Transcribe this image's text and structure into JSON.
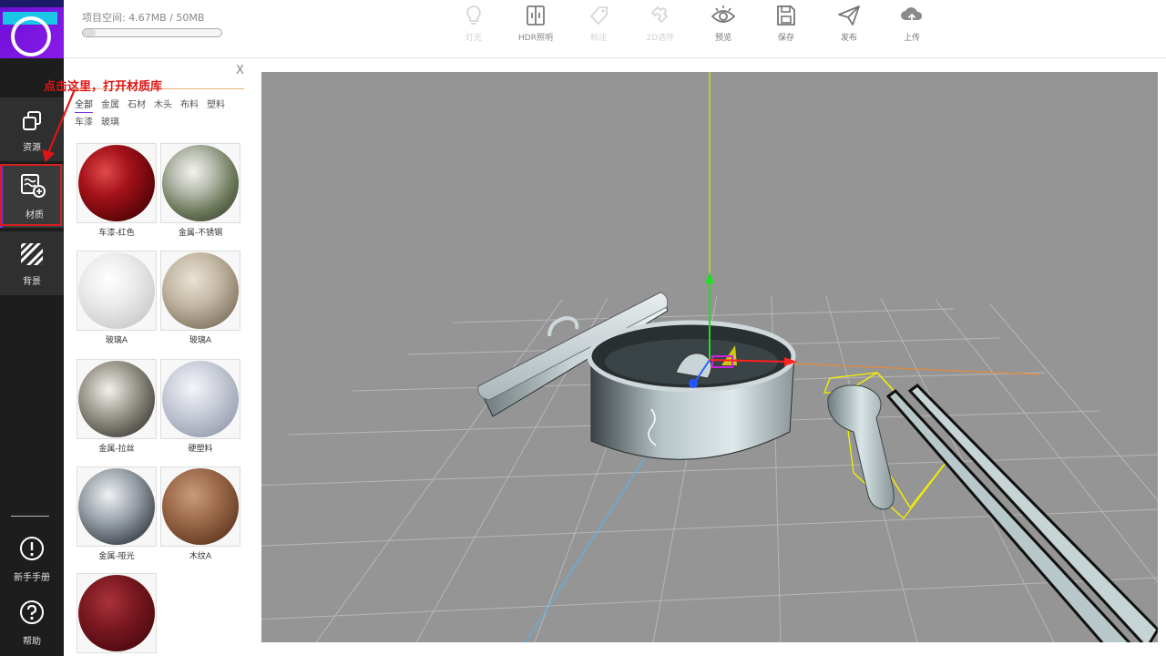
{
  "sidebar": {
    "items": [
      {
        "label": "资源"
      },
      {
        "label": "材质"
      },
      {
        "label": "背景"
      },
      {
        "label": "新手手册"
      },
      {
        "label": "帮助"
      }
    ]
  },
  "annotation": {
    "text": "点击这里，打开材质库",
    "color": "#e01414"
  },
  "header": {
    "space_label": "项目空间: 4.67MB / 50MB",
    "space_used_fraction": 0.09,
    "tools": [
      {
        "label": "灯光",
        "icon": "bulb-icon",
        "enabled": false
      },
      {
        "label": "HDR照明",
        "icon": "hdr-icon",
        "enabled": false
      },
      {
        "label": "标注",
        "icon": "tag-icon",
        "enabled": false
      },
      {
        "label": "2D选件",
        "icon": "puzzle-icon",
        "enabled": false
      },
      {
        "label": "预览",
        "icon": "eye-icon",
        "enabled": true
      },
      {
        "label": "保存",
        "icon": "save-icon",
        "enabled": true
      },
      {
        "label": "发布",
        "icon": "send-icon",
        "enabled": true
      },
      {
        "label": "上传",
        "icon": "cloud-upload-icon",
        "enabled": true
      }
    ]
  },
  "panel": {
    "close_label": "X",
    "categories": [
      "全部",
      "金属",
      "石材",
      "木头",
      "布料",
      "塑料",
      "车漆",
      "玻璃"
    ],
    "active_category": "全部",
    "materials": [
      {
        "name": "车漆-红色"
      },
      {
        "name": "金属-不锈钢"
      },
      {
        "name": "玻璃A"
      },
      {
        "name": "玻璃A"
      },
      {
        "name": "金属-拉丝"
      },
      {
        "name": "硬塑料"
      },
      {
        "name": "金属-哑光"
      },
      {
        "name": "木纹A"
      },
      {
        "name": ""
      }
    ]
  },
  "colors": {
    "accent": "#7a2fe0",
    "sidebar_bg": "#1d1d1d",
    "viewport_bg": "#959595",
    "highlight_box": "#d42020",
    "selection_box": "#ffff00",
    "axis_x": "#ff2020",
    "axis_y": "#22dd22",
    "axis_z": "#2266ff"
  }
}
